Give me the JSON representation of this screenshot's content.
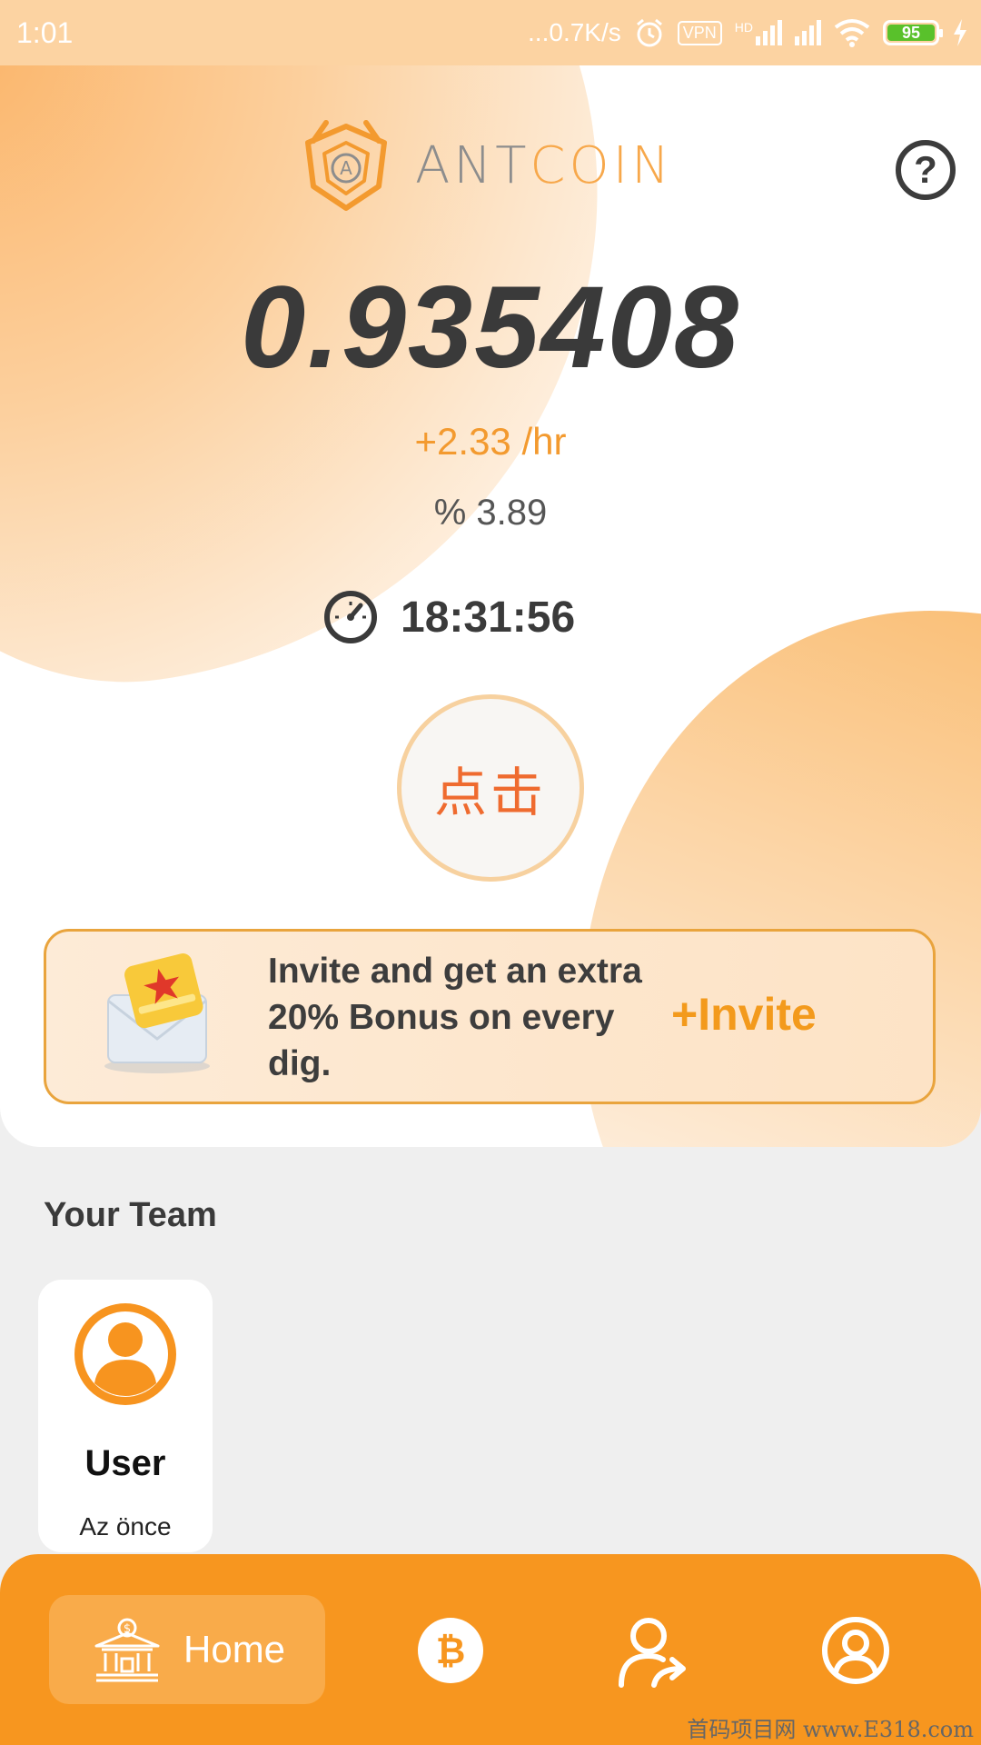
{
  "status_bar": {
    "time": "1:01",
    "network_speed": "...0.7K/s",
    "vpn_label": "VPN",
    "hd_label": "HD",
    "battery_level": "95"
  },
  "header": {
    "logo_ant": "ANT",
    "logo_coin": "COIN",
    "logo_letter": "A",
    "help_glyph": "?"
  },
  "mining": {
    "balance": "0.935408",
    "rate": "+2.33 /hr",
    "percentage": "% 3.89",
    "countdown": "18:31:56",
    "tap_button_label": "点击"
  },
  "invite": {
    "text": "Invite and get an extra 20% Bonus on every dig.",
    "link_label": "+Invite"
  },
  "team": {
    "title": "Your Team",
    "members": [
      {
        "name": "User",
        "time": "Az önce"
      }
    ]
  },
  "bottom_nav": {
    "home_label": "Home",
    "items": [
      "home-icon",
      "bitcoin-icon",
      "share-user-icon",
      "profile-icon"
    ]
  },
  "watermark": "首码项目网 www.E318.com",
  "colors": {
    "accent": "#f7961f",
    "rate": "#f39a2f",
    "tap_text": "#ef6b2f",
    "invite_border": "#e9a43d"
  }
}
